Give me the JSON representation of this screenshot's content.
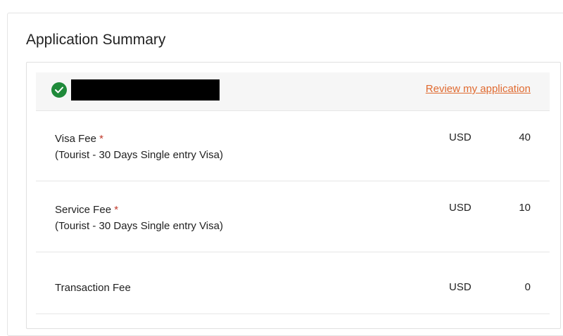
{
  "summary": {
    "title": "Application Summary",
    "review_link": "Review my application",
    "status_icon": "check-circle-icon",
    "status_color": "#1f8a3a",
    "link_color": "#e06a30"
  },
  "fees": [
    {
      "label": "Visa Fee",
      "required_marker": "*",
      "subtitle": "(Tourist - 30 Days Single entry Visa)",
      "currency": "USD",
      "amount": "40"
    },
    {
      "label": "Service Fee",
      "required_marker": "*",
      "subtitle": "(Tourist - 30 Days Single entry Visa)",
      "currency": "USD",
      "amount": "10"
    },
    {
      "label": "Transaction Fee",
      "currency": "USD",
      "amount": "0"
    }
  ]
}
